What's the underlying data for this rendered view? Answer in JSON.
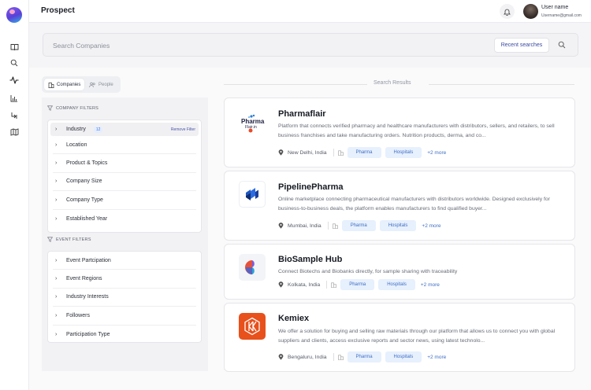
{
  "app": {
    "title": "Prospect"
  },
  "user": {
    "name": "User name",
    "email": "Username@gmail.com"
  },
  "search": {
    "placeholder": "Search Companies",
    "recent_label": "Recent searches"
  },
  "tabs": [
    {
      "label": "Companies",
      "active": true
    },
    {
      "label": "People",
      "active": false
    }
  ],
  "filters": {
    "company_section": "COMPANY FILTERS",
    "company_items": [
      {
        "label": "Industry",
        "count": "12",
        "action": "Remove Filter"
      },
      {
        "label": "Location"
      },
      {
        "label": "Product & Topics"
      },
      {
        "label": "Company Size"
      },
      {
        "label": "Company Type"
      },
      {
        "label": "Established Year"
      }
    ],
    "event_section": "EVENT FILTERS",
    "event_items": [
      {
        "label": "Event Partcipation"
      },
      {
        "label": "Event Regions"
      },
      {
        "label": "Industry Interests"
      },
      {
        "label": "Followers"
      },
      {
        "label": "Participation Type"
      }
    ]
  },
  "results": {
    "title": "Search Results",
    "items": [
      {
        "name": "Pharmaflair",
        "logo_text": "Pharma Flair.in",
        "description": "Platform that connects verified pharmacy and healthcare manufacturers with distributors, sellers, and retailers, to sell business franchises and take manufacturing orders. Nutrition products, derma, and co...",
        "location": "New Delhi, India",
        "tags": [
          "Pharma",
          "Hospitals"
        ],
        "more": "+2 more"
      },
      {
        "name": "PipelinePharma",
        "description": "Online marketplace connecting pharmaceutical manufacturers with distributors worldwide. Designed exclusively for business-to-business deals, the platform enables manufacturers to find qualified buyer...",
        "location": "Mumbai, India",
        "tags": [
          "Pharma",
          "Hospitals"
        ],
        "more": "+2 more"
      },
      {
        "name": "BioSample Hub",
        "description": "Connect Biotechs and Biobanks directly, for sample sharing with traceability",
        "location": "Kolkata, India",
        "tags": [
          "Pharma",
          "Hospitals"
        ],
        "more": "+2 more"
      },
      {
        "name": "Kemiex",
        "description": "We offer a solution for buying and selling raw materials through our platform that allows us to connect you with global suppliers and clients, access exclusive reports and sector news, using latest technolo...",
        "location": "Bengaluru, India",
        "tags": [
          "Pharma",
          "Hospitals"
        ],
        "more": "+2 more"
      }
    ]
  },
  "colors": {
    "accent": "#3b4aa0",
    "tag_bg": "#e7f0fd",
    "tag_text": "#3f6fc4",
    "kemiex_orange": "#e8501c"
  }
}
